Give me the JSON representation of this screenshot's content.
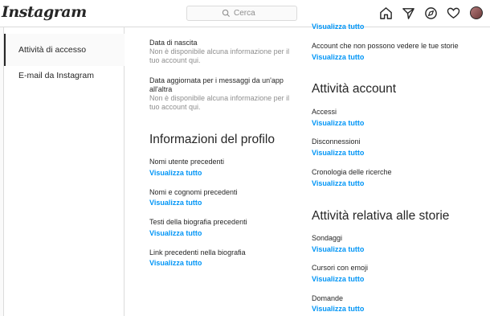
{
  "header": {
    "logo": "Instagram",
    "search_placeholder": "Cerca"
  },
  "sidebar": {
    "items": [
      {
        "label": "Attività di accesso"
      },
      {
        "label": "E-mail da Instagram"
      }
    ]
  },
  "col1": {
    "birth_label": "Data di nascita",
    "birth_sub": "Non è disponibile alcuna informazione per il tuo account qui.",
    "msg_label": "Data aggiornata per i messaggi da un'app all'altra",
    "msg_sub": "Non è disponibile alcuna informazione per il tuo account qui.",
    "profile_heading": "Informazioni del profilo",
    "items": [
      {
        "label": "Nomi utente precedenti",
        "link": "Visualizza tutto"
      },
      {
        "label": "Nomi e cognomi precedenti",
        "link": "Visualizza tutto"
      },
      {
        "label": "Testi della biografia precedenti",
        "link": "Visualizza tutto"
      },
      {
        "label": "Link precedenti nella biografia",
        "link": "Visualizza tutto"
      }
    ]
  },
  "col2": {
    "top_link": "Visualizza tutto",
    "hidden_stories_label": "Account che non possono vedere le tue storie",
    "hidden_stories_link": "Visualizza tutto",
    "account_heading": "Attività account",
    "account_items": [
      {
        "label": "Accessi",
        "link": "Visualizza tutto"
      },
      {
        "label": "Disconnessioni",
        "link": "Visualizza tutto"
      },
      {
        "label": "Cronologia delle ricerche",
        "link": "Visualizza tutto"
      }
    ],
    "stories_heading": "Attività relativa alle storie",
    "stories_items": [
      {
        "label": "Sondaggi",
        "link": "Visualizza tutto"
      },
      {
        "label": "Cursori con emoji",
        "link": "Visualizza tutto"
      },
      {
        "label": "Domande",
        "link": "Visualizza tutto"
      }
    ]
  },
  "colors": {
    "link": "#0095f6",
    "text": "#262626",
    "muted": "#8e8e8e",
    "border": "#dbdbdb"
  }
}
